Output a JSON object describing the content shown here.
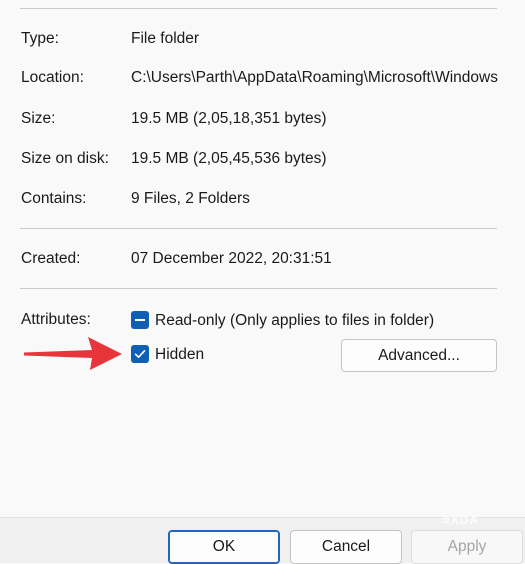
{
  "properties": {
    "type_label": "Type:",
    "type_value": "File folder",
    "location_label": "Location:",
    "location_value": "C:\\Users\\Parth\\AppData\\Roaming\\Microsoft\\Windows",
    "size_label": "Size:",
    "size_value": "19.5 MB (2,05,18,351 bytes)",
    "size_on_disk_label": "Size on disk:",
    "size_on_disk_value": "19.5 MB (2,05,45,536 bytes)",
    "contains_label": "Contains:",
    "contains_value": "9 Files, 2 Folders",
    "created_label": "Created:",
    "created_value": "07 December 2022, 20:31:51"
  },
  "attributes": {
    "label": "Attributes:",
    "readonly_label": "Read-only (Only applies to files in folder)",
    "readonly_state": "indeterminate",
    "hidden_label": "Hidden",
    "hidden_checked": true,
    "advanced_label": "Advanced..."
  },
  "footer": {
    "ok_label": "OK",
    "cancel_label": "Cancel",
    "apply_label": "Apply"
  },
  "watermark": {
    "text": "XDA"
  },
  "colors": {
    "accent": "#0f5fb5",
    "annotation_arrow": "#e8343b"
  }
}
